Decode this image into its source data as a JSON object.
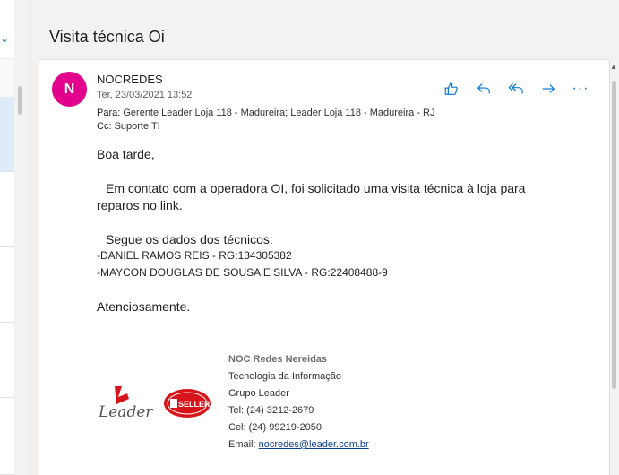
{
  "email": {
    "subject": "Visita técnica Oi",
    "avatar_initial": "N",
    "sender": "NOCREDES",
    "date": "Ter, 23/03/2021 13:52",
    "to_label": "Para:",
    "to_value": "Gerente Leader Loja 118 - Madureira; Leader Loja 118 - Madureira - RJ",
    "cc_label": "Cc:",
    "cc_value": "Suporte TI",
    "body": {
      "greeting": "Boa tarde,",
      "para1_line1": "Em contato com a operadora OI, foi solicitado uma visita técnica à loja para",
      "para1_line2": "reparos no link.",
      "para2": "Segue os dados dos técnicos:",
      "tech1": "-DANIEL RAMOS REIS - RG:134305382",
      "tech2": "-MAYCON DOUGLAS DE SOUSA E SILVA - RG:22408488-9",
      "closing": "Atenciosamente."
    },
    "signature": {
      "title": "NOC Redes Nereidas",
      "line1": "Tecnologia da Informação",
      "line2": "Grupo Leader",
      "tel": "Tel: (24) 3212-2679",
      "cel": "Cel: (24) 99219-2050",
      "email_label": "Email:",
      "email_link": "nocredes@leader.com.br",
      "logo_leader_text": "Leader",
      "logo_seller_text": "SELLER"
    }
  },
  "actions": {
    "like_icon": "like-icon",
    "reply_icon": "reply-icon",
    "reply_all_icon": "reply-all-icon",
    "forward_icon": "forward-icon",
    "more_icon": "more-icon",
    "more_label": "···"
  },
  "colors": {
    "avatar": "#e3008c",
    "accent": "#0078d4",
    "leader_red": "#d7141a"
  }
}
